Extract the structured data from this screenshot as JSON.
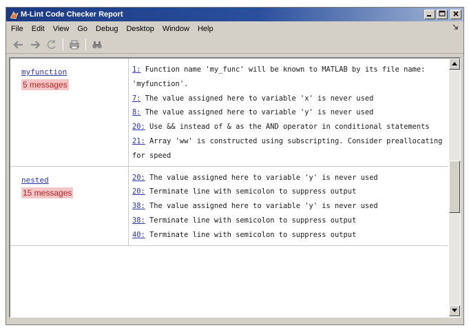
{
  "window": {
    "title": "M-Lint Code Checker Report"
  },
  "menu": {
    "items": [
      "File",
      "Edit",
      "View",
      "Go",
      "Debug",
      "Desktop",
      "Window",
      "Help"
    ]
  },
  "report": {
    "rows": [
      {
        "function": "myfunction",
        "count": "5 messages",
        "messages": [
          {
            "line": "1:",
            "text": "Function name 'my_func' will be known to MATLAB by its file name: 'myfunction'."
          },
          {
            "line": "7:",
            "text": "The value assigned here to variable 'x' is never used"
          },
          {
            "line": "8:",
            "text": "The value assigned here to variable 'y' is never used"
          },
          {
            "line": "20:",
            "text": "Use && instead of & as the AND operator in conditional statements"
          },
          {
            "line": "21:",
            "text": "Array 'ww' is constructed using subscripting. Consider preallocating for speed"
          }
        ]
      },
      {
        "function": "nested",
        "count": "15 messages",
        "messages": [
          {
            "line": "20:",
            "text": "The value assigned here to variable 'y' is never used"
          },
          {
            "line": "20:",
            "text": "Terminate line with semicolon to suppress output"
          },
          {
            "line": "38:",
            "text": "The value assigned here to variable 'y' is never used"
          },
          {
            "line": "38:",
            "text": "Terminate line with semicolon to suppress output"
          },
          {
            "line": "40:",
            "text": "Terminate line with semicolon to suppress output"
          }
        ]
      }
    ]
  },
  "colors": {
    "titlebar": "#1b3a84",
    "link": "#2a34a8",
    "count_bg": "#f5c6c6",
    "count_fg": "#b22222"
  },
  "icons": {
    "app": "matlab-logo-icon",
    "back": "back-arrow-icon",
    "forward": "forward-arrow-icon",
    "refresh": "refresh-icon",
    "print": "print-icon",
    "find": "binoculars-icon"
  }
}
